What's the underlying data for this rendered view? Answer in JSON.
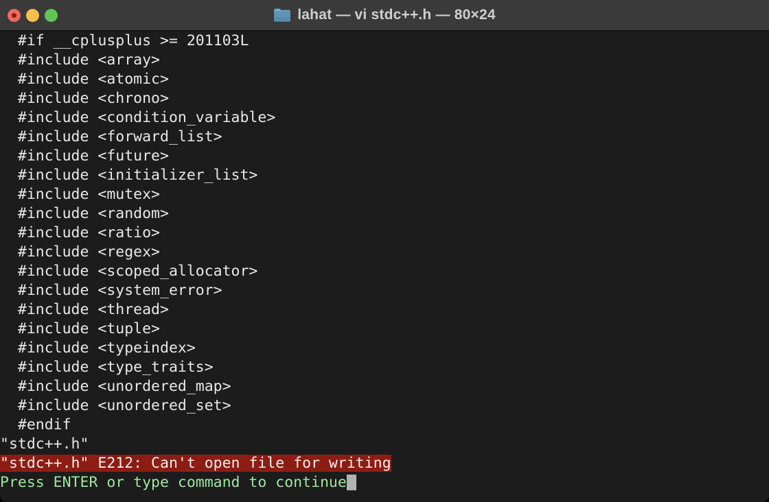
{
  "window": {
    "title": "lahat — vi stdc++.h — 80×24",
    "folder_icon": "folder-icon",
    "controls": [
      {
        "name": "close-button",
        "label": "Close",
        "color": "#ec6a5e"
      },
      {
        "name": "minimize-button",
        "label": "Minimize",
        "color": "#f4bf4f"
      },
      {
        "name": "maximize-button",
        "label": "Maximize",
        "color": "#61c554"
      }
    ],
    "titlebar_color": "#3a3a3a",
    "background_color": "#1c1c1c"
  },
  "terminal": {
    "columns": 80,
    "rows": 24,
    "foreground_color": "#e8e8e8",
    "background_color": "#1c1c1c",
    "error_background_color": "#8d1c12",
    "prompt_color": "#9ee89e",
    "cursor_color": "#b2b2b2",
    "lines": [
      "  #if __cplusplus >= 201103L",
      "  #include <array>",
      "  #include <atomic>",
      "  #include <chrono>",
      "  #include <condition_variable>",
      "  #include <forward_list>",
      "  #include <future>",
      "  #include <initializer_list>",
      "  #include <mutex>",
      "  #include <random>",
      "  #include <ratio>",
      "  #include <regex>",
      "  #include <scoped_allocator>",
      "  #include <system_error>",
      "  #include <thread>",
      "  #include <tuple>",
      "  #include <typeindex>",
      "  #include <type_traits>",
      "  #include <unordered_map>",
      "  #include <unordered_set>",
      "  #endif"
    ],
    "filename_line": "\"stdc++.h\"",
    "error_line": "\"stdc++.h\" E212: Can't open file for writing",
    "prompt_line": "Press ENTER or type command to continue"
  }
}
